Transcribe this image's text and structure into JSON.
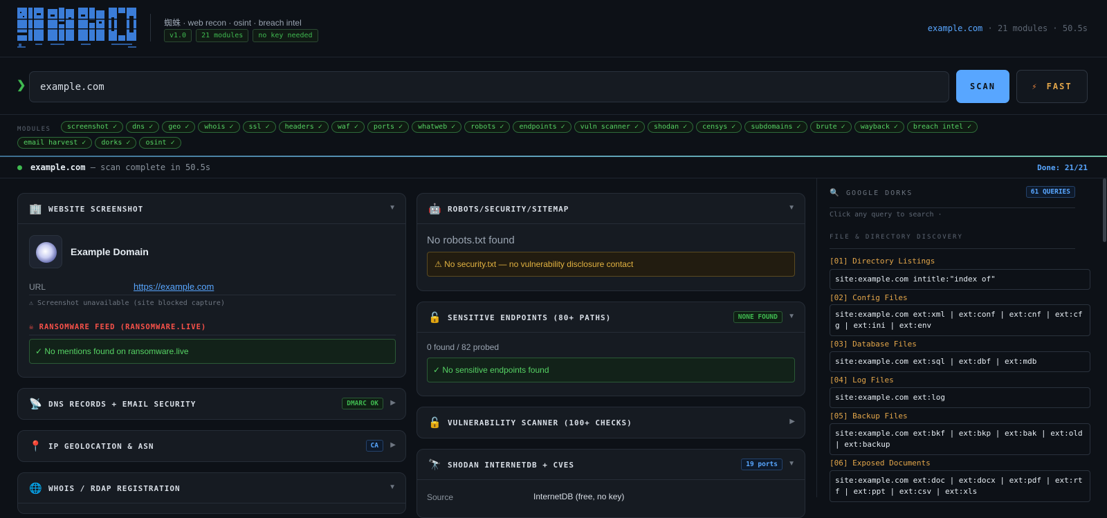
{
  "header": {
    "subtitle": "蜘蛛 · web recon · osint · breach intel",
    "tags": [
      "v1.0",
      "21 modules",
      "no key needed"
    ],
    "right_domain": "example.com",
    "right_rest": " · 21 modules · 50.5s"
  },
  "search": {
    "prompt": "❯",
    "value": "example.com",
    "scan_label": "SCAN",
    "fast_icon": "⚡",
    "fast_label": "FAST"
  },
  "modules": {
    "label": "MODULES",
    "items": [
      "screenshot ✓",
      "dns ✓",
      "geo ✓",
      "whois ✓",
      "ssl ✓",
      "headers ✓",
      "waf ✓",
      "ports ✓",
      "whatweb ✓",
      "robots ✓",
      "endpoints ✓",
      "vuln scanner ✓",
      "shodan ✓",
      "censys ✓",
      "subdomains ✓",
      "brute ✓",
      "wayback ✓",
      "breach intel ✓",
      "email harvest ✓",
      "dorks ✓",
      "osint ✓"
    ]
  },
  "status": {
    "domain": "example.com",
    "message": " — scan complete in 50.5s",
    "done": "Done: 21/21"
  },
  "cards": {
    "screenshot": {
      "icon": "🏢",
      "title": "WEBSITE SCREENSHOT",
      "chevron": "▼",
      "site_title": "Example Domain",
      "url_key": "URL",
      "url_val": "https://example.com",
      "note": "⚠ Screenshot unavailable (site blocked capture)",
      "ransom_title": "☠ RANSOMWARE FEED (RANSOMWARE.LIVE)",
      "ransom_result": "✓ No mentions found on ransomware.live"
    },
    "dns": {
      "icon": "📡",
      "title": "DNS RECORDS + EMAIL SECURITY",
      "badge": "DMARC OK",
      "chevron": "▶"
    },
    "geo": {
      "icon": "📍",
      "title": "IP GEOLOCATION & ASN",
      "badge": "CA",
      "chevron": "▶"
    },
    "whois": {
      "icon": "🌐",
      "title": "WHOIS / RDAP REGISTRATION",
      "chevron": "▼"
    },
    "robots": {
      "icon": "🤖",
      "title": "ROBOTS/SECURITY/SITEMAP",
      "chevron": "▼",
      "line1": "No robots.txt found",
      "warning": "⚠ No security.txt — no vulnerability disclosure contact"
    },
    "endpoints": {
      "icon": "🔓",
      "title": "SENSITIVE ENDPOINTS (80+ PATHS)",
      "badge": "NONE FOUND",
      "chevron": "▼",
      "count": "0 found / 82 probed",
      "result": "✓ No sensitive endpoints found"
    },
    "vuln": {
      "icon": "🔓",
      "title": "VULNERABILITY SCANNER (100+ CHECKS)",
      "chevron": "▶"
    },
    "shodan": {
      "icon": "🔭",
      "title": "SHODAN INTERNETDB + CVES",
      "badge": "19 ports",
      "chevron": "▼",
      "row_key": "Source",
      "row_val": "InternetDB (free, no key)"
    }
  },
  "dorks": {
    "icon": "🔍",
    "title": "GOOGLE DORKS",
    "badge": "61 QUERIES",
    "hint": "Click any query to search ·",
    "section": "FILE & DIRECTORY DISCOVERY",
    "items": [
      {
        "name": "[01] Directory Listings",
        "query": "site:example.com intitle:\"index of\""
      },
      {
        "name": "[02] Config Files",
        "query": "site:example.com ext:xml | ext:conf | ext:cnf | ext:cfg | ext:ini | ext:env"
      },
      {
        "name": "[03] Database Files",
        "query": "site:example.com ext:sql | ext:dbf | ext:mdb"
      },
      {
        "name": "[04] Log Files",
        "query": "site:example.com ext:log"
      },
      {
        "name": "[05] Backup Files",
        "query": "site:example.com ext:bkf | ext:bkp | ext:bak | ext:old | ext:backup"
      },
      {
        "name": "[06] Exposed Documents",
        "query": "site:example.com ext:doc | ext:docx | ext:pdf | ext:rtf | ext:ppt | ext:csv | ext:xls"
      }
    ]
  }
}
